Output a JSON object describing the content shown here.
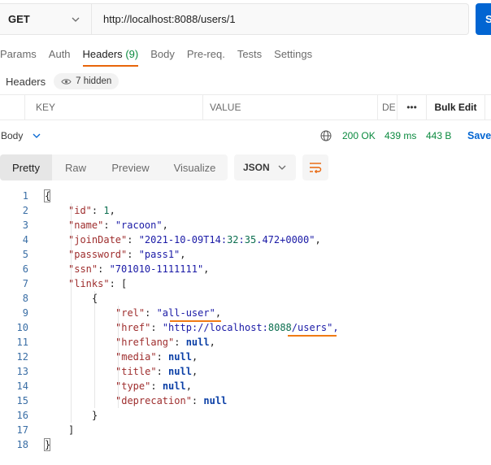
{
  "request": {
    "method": "GET",
    "url": "http://localhost:8088/users/1",
    "send_label": "S"
  },
  "tabs": [
    {
      "label": "Params"
    },
    {
      "label": "Auth"
    },
    {
      "label": "Headers",
      "count": "(9)",
      "active": true
    },
    {
      "label": "Body"
    },
    {
      "label": "Pre-req."
    },
    {
      "label": "Tests"
    },
    {
      "label": "Settings"
    }
  ],
  "headers_section": {
    "title": "Headers",
    "hidden_count": "7 hidden"
  },
  "table": {
    "col_key": "KEY",
    "col_value": "VALUE",
    "col_desc": "DE",
    "more": "•••",
    "bulk_edit": "Bulk Edit"
  },
  "response": {
    "body_label": "Body",
    "status": "200 OK",
    "time": "439 ms",
    "size": "443 B",
    "save_label": "Save"
  },
  "view_tabs": [
    {
      "label": "Pretty",
      "active": true
    },
    {
      "label": "Raw"
    },
    {
      "label": "Preview"
    },
    {
      "label": "Visualize"
    }
  ],
  "format": "JSON",
  "code_lines": [
    "{",
    "\"id\": 1,",
    "\"name\": \"racoon\",",
    "\"joinDate\": \"2021-10-09T14:32:35.472+0000\",",
    "\"password\": \"pass1\",",
    "\"ssn\": \"701010-1111111\",",
    "\"links\": [",
    "{",
    "\"rel\": \"all-user\",",
    "\"href\": \"http://localhost:8088/users\",",
    "\"hreflang\": null,",
    "\"media\": null,",
    "\"title\": null,",
    "\"type\": null,",
    "\"deprecation\": null",
    "}",
    "]",
    "}"
  ],
  "colors": {
    "accent": "#e8650a",
    "send": "#0265d2",
    "success": "#0b8a3f"
  }
}
